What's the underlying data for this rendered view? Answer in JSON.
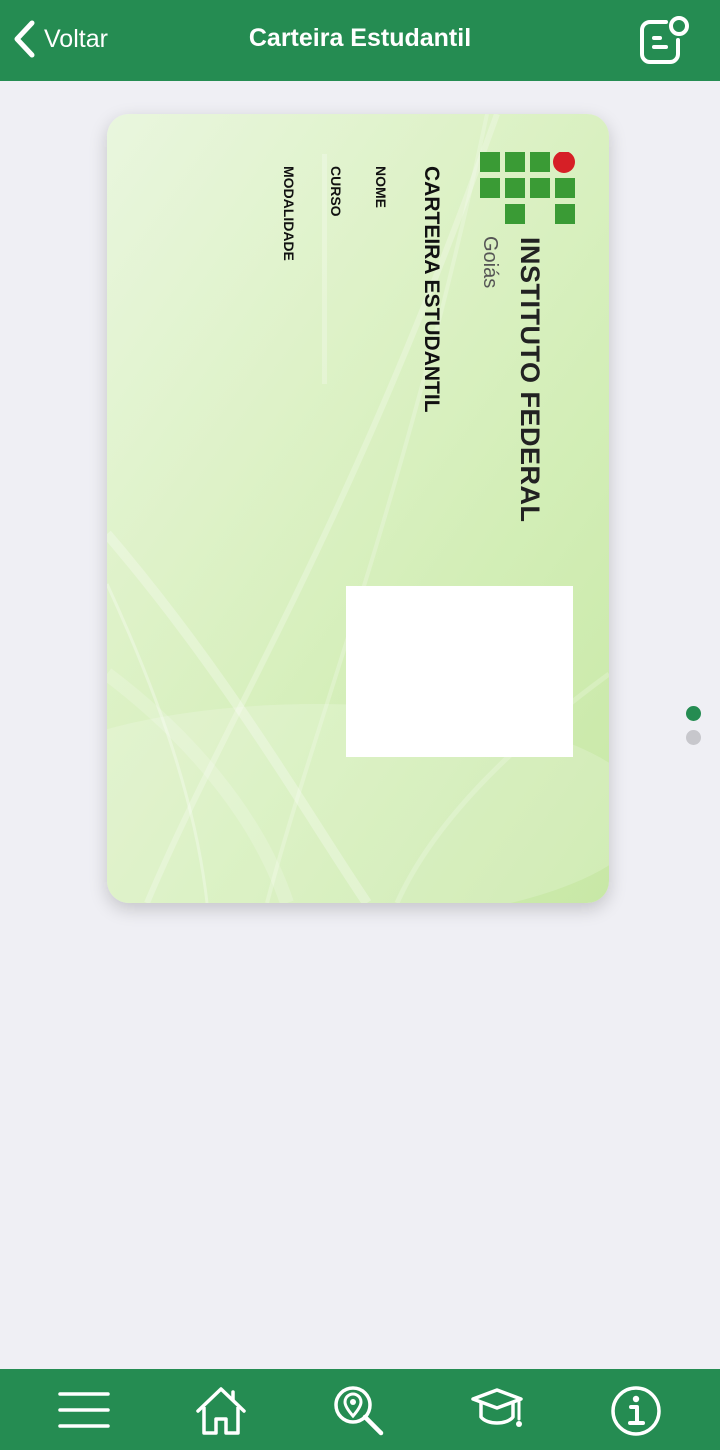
{
  "header": {
    "back_label": "Voltar",
    "title": "Carteira Estudantil",
    "action_icon": "share-note-icon"
  },
  "card": {
    "logo_name": "INSTITUTO FEDERAL",
    "logo_region": "Goiás",
    "title": "CARTEIRA ESTUDANTIL",
    "fields": {
      "nome": "NOME",
      "curso": "CURSO",
      "modalidade": "MODALIDADE"
    }
  },
  "pager": {
    "total": 2,
    "active_index": 0
  },
  "bottom_nav": {
    "items": [
      "menu-icon",
      "home-icon",
      "location-search-icon",
      "graduation-cap-icon",
      "info-icon"
    ]
  },
  "colors": {
    "brand_green": "#258c52",
    "logo_green": "#3a9b35",
    "logo_red": "#d61f26",
    "page_bg": "#efeff4",
    "dot_inactive": "#c7c7cc"
  }
}
